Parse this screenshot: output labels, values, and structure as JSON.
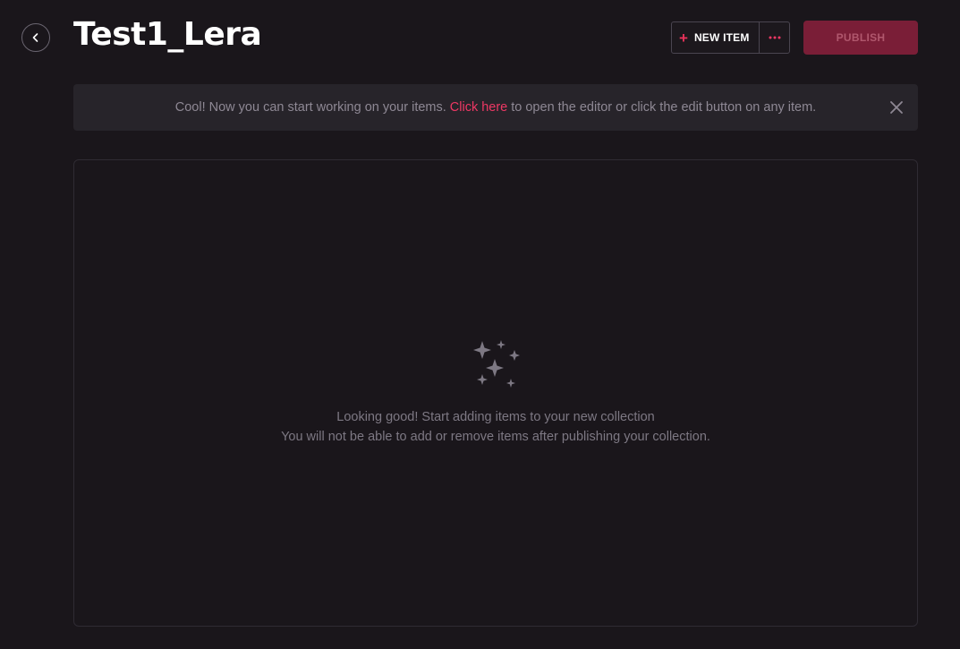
{
  "header": {
    "title": "Test1_Lera",
    "new_item_label": "NEW ITEM",
    "publish_label": "PUBLISH"
  },
  "banner": {
    "text_before": "Cool! Now you can start working on your items.",
    "link_text": "Click here",
    "text_after": "to open the editor or click the edit button on any item."
  },
  "empty_state": {
    "line1": "Looking good! Start adding items to your new collection",
    "line2": "You will not be able to add or remove items after publishing your collection."
  },
  "icons": {
    "back": "chevron-left-icon",
    "plus": "plus-icon",
    "more": "more-horizontal-icon",
    "close": "close-icon",
    "empty": "sparkles-icon"
  },
  "colors": {
    "background": "#1a161b",
    "accent": "#ee3864",
    "publish_bg": "#7a1e37"
  }
}
